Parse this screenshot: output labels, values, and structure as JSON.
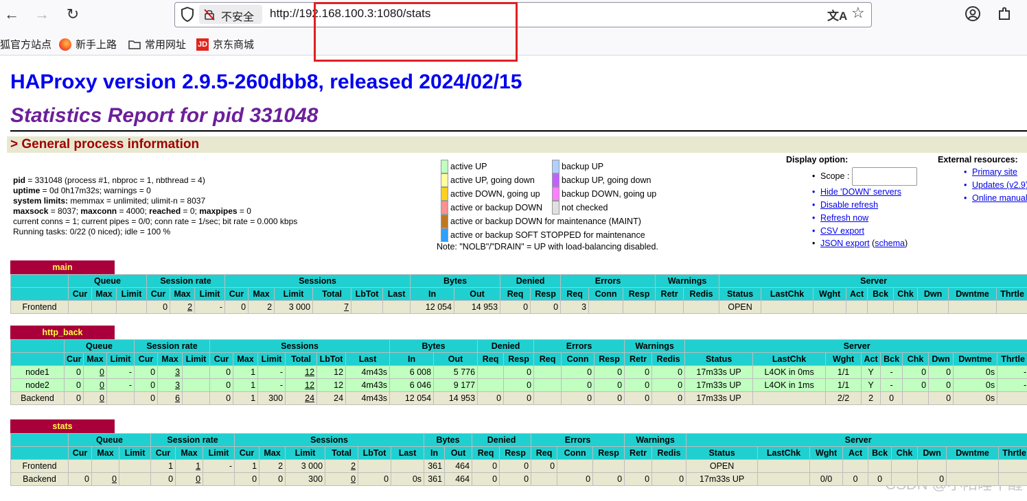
{
  "browser": {
    "security_label": "不安全",
    "url": "http://192.168.100.3:1080/stats",
    "bookmarks": [
      {
        "label": "狐官方站点",
        "icon": "firefox-icon"
      },
      {
        "label": "新手上路",
        "icon": "firefox-icon"
      },
      {
        "label": "常用网址",
        "icon": "folder-icon"
      },
      {
        "label": "京东商城",
        "icon": "jd-icon"
      }
    ]
  },
  "page": {
    "title": "HAProxy version 2.9.5-260dbb8, released 2024/02/15",
    "subtitle": "Statistics Report for pid 331048",
    "section_title": "> General process information"
  },
  "process": {
    "line1_label": "pid",
    "line1": " = 331048 (process #1, nbproc = 1, nbthread = 4)",
    "line2_label": "uptime",
    "line2": " = 0d 0h17m32s; warnings = 0",
    "line3_label": "system limits:",
    "line3": " memmax = unlimited; ulimit-n = 8037",
    "line4_a": "maxsock",
    "line4_b": " = 8037; ",
    "line4_c": "maxconn",
    "line4_d": " = 4000; ",
    "line4_e": "reached",
    "line4_f": " = 0; ",
    "line4_g": "maxpipes",
    "line4_h": " = 0",
    "line5": "current conns = 1; current pipes = 0/0; conn rate = 1/sec; bit rate = 0.000 kbps",
    "line6": "Running tasks: 0/22 (0 niced); idle = 100 %"
  },
  "legend": {
    "items": [
      {
        "label": "active UP",
        "color": "#c0ffc0"
      },
      {
        "label": "active UP, going down",
        "color": "#ffffa0"
      },
      {
        "label": "active DOWN, going up",
        "color": "#ffd020"
      },
      {
        "label": "active or backup DOWN",
        "color": "#ff9090"
      },
      {
        "label": "active or backup DOWN for maintenance (MAINT)",
        "color": "#c07820"
      },
      {
        "label": "active or backup SOFT STOPPED for maintenance",
        "color": "#30a0ff"
      },
      {
        "label": "backup UP",
        "color": "#b0d0ff"
      },
      {
        "label": "backup UP, going down",
        "color": "#c060ff"
      },
      {
        "label": "backup DOWN, going up",
        "color": "#ff80ff"
      },
      {
        "label": "not checked",
        "color": "#e0e0e0"
      }
    ],
    "note": "Note: \"NOLB\"/\"DRAIN\" = UP with load-balancing disabled."
  },
  "display_option": {
    "heading": "Display option:",
    "scope_label": "Scope :",
    "scope_value": "",
    "links": [
      "Hide 'DOWN' servers",
      "Disable refresh",
      "Refresh now",
      "CSV export"
    ],
    "json_export": "JSON export",
    "schema": "schema"
  },
  "external": {
    "heading": "External resources:",
    "links": [
      "Primary site",
      "Updates (v2.9)",
      "Online manual"
    ]
  },
  "table_groups": [
    "Queue",
    "Session rate",
    "Sessions",
    "Bytes",
    "Denied",
    "Errors",
    "Warnings",
    "Server"
  ],
  "table_cols": [
    "Cur",
    "Max",
    "Limit",
    "Cur",
    "Max",
    "Limit",
    "Cur",
    "Max",
    "Limit",
    "Total",
    "LbTot",
    "Last",
    "In",
    "Out",
    "Req",
    "Resp",
    "Req",
    "Conn",
    "Resp",
    "Retr",
    "Redis",
    "Status",
    "LastChk",
    "Wght",
    "Act",
    "Bck",
    "Chk",
    "Dwn",
    "Dwntme",
    "Thrtle"
  ],
  "proxies": {
    "main": {
      "name": "main",
      "rows": [
        {
          "name": "Frontend",
          "cells": [
            "",
            "",
            "",
            "0",
            "2",
            "-",
            "0",
            "2",
            "3 000",
            "7",
            "",
            "",
            "12 054",
            "14 953",
            "0",
            "0",
            "3",
            "",
            "",
            "",
            "",
            "OPEN",
            "",
            "",
            "",
            "",
            "",
            "",
            "",
            ""
          ]
        }
      ]
    },
    "http_back": {
      "name": "http_back",
      "rows": [
        {
          "name": "node1",
          "cells": [
            "0",
            "0",
            "-",
            "0",
            "3",
            "",
            "0",
            "1",
            "-",
            "12",
            "12",
            "4m43s",
            "6 008",
            "5 776",
            "",
            "0",
            "",
            "0",
            "0",
            "0",
            "0",
            "17m33s UP",
            "L4OK in 0ms",
            "1/1",
            "Y",
            "-",
            "0",
            "0",
            "0s",
            "-"
          ]
        },
        {
          "name": "node2",
          "cells": [
            "0",
            "0",
            "-",
            "0",
            "3",
            "",
            "0",
            "1",
            "-",
            "12",
            "12",
            "4m43s",
            "6 046",
            "9 177",
            "",
            "0",
            "",
            "0",
            "0",
            "0",
            "0",
            "17m33s UP",
            "L4OK in 1ms",
            "1/1",
            "Y",
            "-",
            "0",
            "0",
            "0s",
            "-"
          ]
        },
        {
          "name": "Backend",
          "cells": [
            "0",
            "0",
            "",
            "0",
            "6",
            "",
            "0",
            "1",
            "300",
            "24",
            "24",
            "4m43s",
            "12 054",
            "14 953",
            "0",
            "0",
            "",
            "0",
            "0",
            "0",
            "0",
            "17m33s UP",
            "",
            "2/2",
            "2",
            "0",
            "",
            "0",
            "0s",
            ""
          ]
        }
      ]
    },
    "stats": {
      "name": "stats",
      "rows": [
        {
          "name": "Frontend",
          "cells": [
            "",
            "",
            "",
            "1",
            "1",
            "-",
            "1",
            "2",
            "3 000",
            "2",
            "",
            "",
            "361",
            "464",
            "0",
            "0",
            "0",
            "",
            "",
            "",
            "",
            "OPEN",
            "",
            "",
            "",
            "",
            "",
            "",
            "",
            ""
          ]
        },
        {
          "name": "Backend",
          "cells": [
            "0",
            "0",
            "",
            "0",
            "0",
            "",
            "0",
            "0",
            "300",
            "0",
            "0",
            "0s",
            "361",
            "464",
            "0",
            "0",
            "",
            "0",
            "0",
            "0",
            "0",
            "17m33s UP",
            "",
            "0/0",
            "0",
            "0",
            "",
            "0",
            "",
            ""
          ]
        }
      ]
    }
  },
  "watermark": "CSDN @小阳睡不醒"
}
